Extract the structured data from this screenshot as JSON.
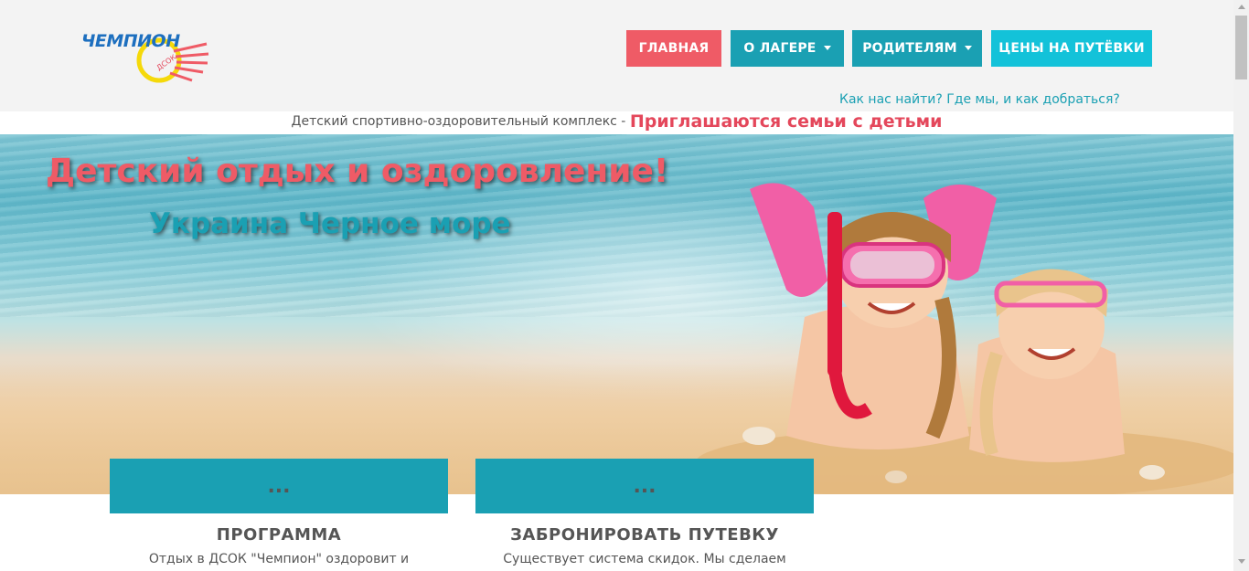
{
  "logo": {
    "text": "ЧЕМПИОН",
    "sub": "ДСОК"
  },
  "nav": {
    "home": "ГЛАВНАЯ",
    "camp": "О ЛАГЕРЕ",
    "parents": "РОДИТЕЛЯМ",
    "prices": "ЦЕНЫ НА ПУТЁВКИ"
  },
  "find_link": "Как нас найти? Где мы, и как добраться?",
  "tagline": {
    "plain": "Детский спортивно-оздоровительный комплекс - ",
    "accent": "Приглашаются семьи с детьми"
  },
  "hero": {
    "title": "Детский отдых и оздоровление!",
    "subtitle": "Украина Черное море"
  },
  "cards": [
    {
      "band": "...",
      "title": "ПРОГРАММА",
      "text": "Отдых в ДСОК \"Чемпион\" оздоровит и"
    },
    {
      "band": "...",
      "title": "ЗАБРОНИРОВАТЬ ПУТЕВКУ",
      "text": "Существует система скидок. Мы сделаем"
    }
  ],
  "colors": {
    "coral": "#ef5b66",
    "teal": "#1aa0b3",
    "cyan": "#13c2d9",
    "header_bg": "#f3f3f3"
  }
}
